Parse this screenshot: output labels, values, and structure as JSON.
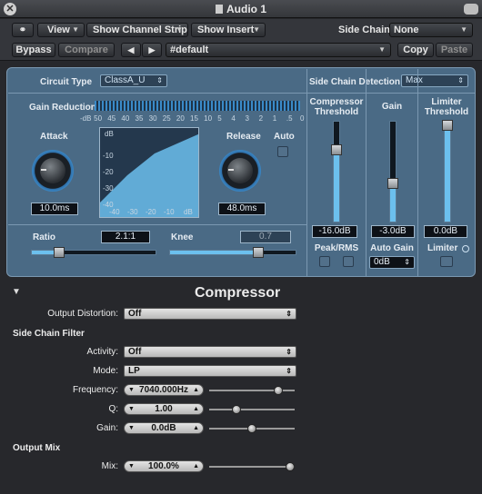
{
  "window": {
    "title": "Audio 1"
  },
  "header": {
    "view_label": "View",
    "show_channel_strip_label": "Show Channel Strip",
    "show_insert_label": "Show Insert",
    "side_chain_label": "Side Chain:",
    "side_chain_value": "None",
    "bypass_label": "Bypass",
    "compare_label": "Compare",
    "preset_value": "#default",
    "copy_label": "Copy",
    "paste_label": "Paste"
  },
  "panel": {
    "circuit_type_label": "Circuit Type",
    "circuit_type_value": "ClassA_U",
    "side_chain_detection_label": "Side Chain Detection",
    "side_chain_detection_value": "Max",
    "gain_reduction_label": "Gain Reduction",
    "gr_scale": [
      "-dB",
      "50",
      "45",
      "40",
      "35",
      "30",
      "25",
      "20",
      "15",
      "10",
      "5",
      "4",
      "3",
      "2",
      "1",
      ".5",
      "0"
    ],
    "attack_label": "Attack",
    "attack_value": "10.0ms",
    "release_label": "Release",
    "release_value": "48.0ms",
    "auto_label": "Auto",
    "graph_db_label": "dB",
    "graph_y_ticks": [
      "-10",
      "-20",
      "-30",
      "-40"
    ],
    "graph_x_ticks": [
      "-40",
      "-30",
      "-20",
      "-10",
      "dB"
    ],
    "ratio_label": "Ratio",
    "ratio_value": "2.1:1",
    "ratio_level": 0.22,
    "knee_label": "Knee",
    "knee_value": "0.7",
    "knee_level": 0.7,
    "threshold_label_1": "Compressor",
    "threshold_label_2": "Threshold",
    "threshold_value": "-16.0dB",
    "threshold_level": 0.72,
    "peak_rms_label": "Peak/RMS",
    "gain_label": "Gain",
    "gain_value": "-3.0dB",
    "gain_level": 0.38,
    "auto_gain_label": "Auto Gain",
    "auto_gain_value": "0dB",
    "limiter_threshold_label_1": "Limiter",
    "limiter_threshold_label_2": "Threshold",
    "limiter_threshold_value": "0.0dB",
    "limiter_threshold_level": 0.96,
    "limiter_label": "Limiter"
  },
  "lower": {
    "section_title": "Compressor",
    "output_distortion_label": "Output Distortion:",
    "output_distortion_value": "Off",
    "side_chain_filter_heading": "Side Chain Filter",
    "activity_label": "Activity:",
    "activity_value": "Off",
    "mode_label": "Mode:",
    "mode_value": "LP",
    "frequency_label": "Frequency:",
    "frequency_value": "7040.000Hz",
    "frequency_level": 0.85,
    "q_label": "Q:",
    "q_value": "1.00",
    "q_level": 0.3,
    "gain_label": "Gain:",
    "gain_value": "0.0dB",
    "gain_level": 0.5,
    "output_mix_heading": "Output Mix",
    "mix_label": "Mix:",
    "mix_value": "100.0%",
    "mix_level": 1.0
  },
  "colors": {
    "panel": "#4a6a85",
    "accent": "#6cc0ee",
    "window_bg": "#27282c"
  }
}
